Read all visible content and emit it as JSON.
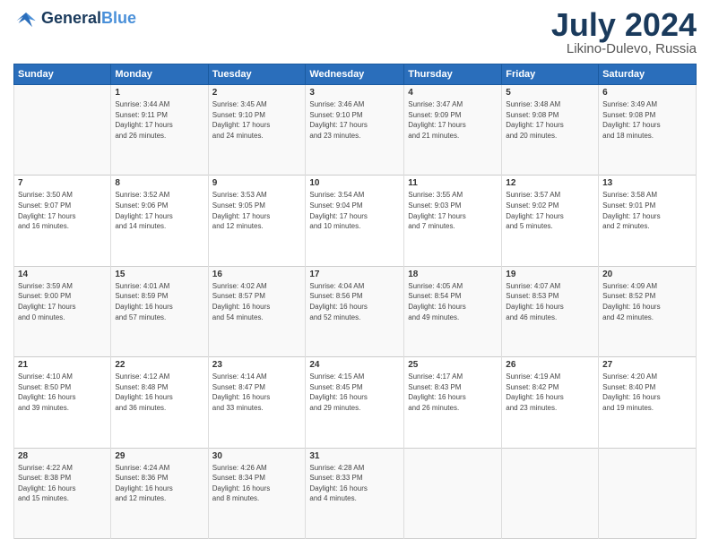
{
  "header": {
    "logo_line1": "General",
    "logo_line2": "Blue",
    "month": "July 2024",
    "location": "Likino-Dulevo, Russia"
  },
  "days_of_week": [
    "Sunday",
    "Monday",
    "Tuesday",
    "Wednesday",
    "Thursday",
    "Friday",
    "Saturday"
  ],
  "weeks": [
    [
      {
        "day": "",
        "info": ""
      },
      {
        "day": "1",
        "info": "Sunrise: 3:44 AM\nSunset: 9:11 PM\nDaylight: 17 hours\nand 26 minutes."
      },
      {
        "day": "2",
        "info": "Sunrise: 3:45 AM\nSunset: 9:10 PM\nDaylight: 17 hours\nand 24 minutes."
      },
      {
        "day": "3",
        "info": "Sunrise: 3:46 AM\nSunset: 9:10 PM\nDaylight: 17 hours\nand 23 minutes."
      },
      {
        "day": "4",
        "info": "Sunrise: 3:47 AM\nSunset: 9:09 PM\nDaylight: 17 hours\nand 21 minutes."
      },
      {
        "day": "5",
        "info": "Sunrise: 3:48 AM\nSunset: 9:08 PM\nDaylight: 17 hours\nand 20 minutes."
      },
      {
        "day": "6",
        "info": "Sunrise: 3:49 AM\nSunset: 9:08 PM\nDaylight: 17 hours\nand 18 minutes."
      }
    ],
    [
      {
        "day": "7",
        "info": "Sunrise: 3:50 AM\nSunset: 9:07 PM\nDaylight: 17 hours\nand 16 minutes."
      },
      {
        "day": "8",
        "info": "Sunrise: 3:52 AM\nSunset: 9:06 PM\nDaylight: 17 hours\nand 14 minutes."
      },
      {
        "day": "9",
        "info": "Sunrise: 3:53 AM\nSunset: 9:05 PM\nDaylight: 17 hours\nand 12 minutes."
      },
      {
        "day": "10",
        "info": "Sunrise: 3:54 AM\nSunset: 9:04 PM\nDaylight: 17 hours\nand 10 minutes."
      },
      {
        "day": "11",
        "info": "Sunrise: 3:55 AM\nSunset: 9:03 PM\nDaylight: 17 hours\nand 7 minutes."
      },
      {
        "day": "12",
        "info": "Sunrise: 3:57 AM\nSunset: 9:02 PM\nDaylight: 17 hours\nand 5 minutes."
      },
      {
        "day": "13",
        "info": "Sunrise: 3:58 AM\nSunset: 9:01 PM\nDaylight: 17 hours\nand 2 minutes."
      }
    ],
    [
      {
        "day": "14",
        "info": "Sunrise: 3:59 AM\nSunset: 9:00 PM\nDaylight: 17 hours\nand 0 minutes."
      },
      {
        "day": "15",
        "info": "Sunrise: 4:01 AM\nSunset: 8:59 PM\nDaylight: 16 hours\nand 57 minutes."
      },
      {
        "day": "16",
        "info": "Sunrise: 4:02 AM\nSunset: 8:57 PM\nDaylight: 16 hours\nand 54 minutes."
      },
      {
        "day": "17",
        "info": "Sunrise: 4:04 AM\nSunset: 8:56 PM\nDaylight: 16 hours\nand 52 minutes."
      },
      {
        "day": "18",
        "info": "Sunrise: 4:05 AM\nSunset: 8:54 PM\nDaylight: 16 hours\nand 49 minutes."
      },
      {
        "day": "19",
        "info": "Sunrise: 4:07 AM\nSunset: 8:53 PM\nDaylight: 16 hours\nand 46 minutes."
      },
      {
        "day": "20",
        "info": "Sunrise: 4:09 AM\nSunset: 8:52 PM\nDaylight: 16 hours\nand 42 minutes."
      }
    ],
    [
      {
        "day": "21",
        "info": "Sunrise: 4:10 AM\nSunset: 8:50 PM\nDaylight: 16 hours\nand 39 minutes."
      },
      {
        "day": "22",
        "info": "Sunrise: 4:12 AM\nSunset: 8:48 PM\nDaylight: 16 hours\nand 36 minutes."
      },
      {
        "day": "23",
        "info": "Sunrise: 4:14 AM\nSunset: 8:47 PM\nDaylight: 16 hours\nand 33 minutes."
      },
      {
        "day": "24",
        "info": "Sunrise: 4:15 AM\nSunset: 8:45 PM\nDaylight: 16 hours\nand 29 minutes."
      },
      {
        "day": "25",
        "info": "Sunrise: 4:17 AM\nSunset: 8:43 PM\nDaylight: 16 hours\nand 26 minutes."
      },
      {
        "day": "26",
        "info": "Sunrise: 4:19 AM\nSunset: 8:42 PM\nDaylight: 16 hours\nand 23 minutes."
      },
      {
        "day": "27",
        "info": "Sunrise: 4:20 AM\nSunset: 8:40 PM\nDaylight: 16 hours\nand 19 minutes."
      }
    ],
    [
      {
        "day": "28",
        "info": "Sunrise: 4:22 AM\nSunset: 8:38 PM\nDaylight: 16 hours\nand 15 minutes."
      },
      {
        "day": "29",
        "info": "Sunrise: 4:24 AM\nSunset: 8:36 PM\nDaylight: 16 hours\nand 12 minutes."
      },
      {
        "day": "30",
        "info": "Sunrise: 4:26 AM\nSunset: 8:34 PM\nDaylight: 16 hours\nand 8 minutes."
      },
      {
        "day": "31",
        "info": "Sunrise: 4:28 AM\nSunset: 8:33 PM\nDaylight: 16 hours\nand 4 minutes."
      },
      {
        "day": "",
        "info": ""
      },
      {
        "day": "",
        "info": ""
      },
      {
        "day": "",
        "info": ""
      }
    ]
  ]
}
